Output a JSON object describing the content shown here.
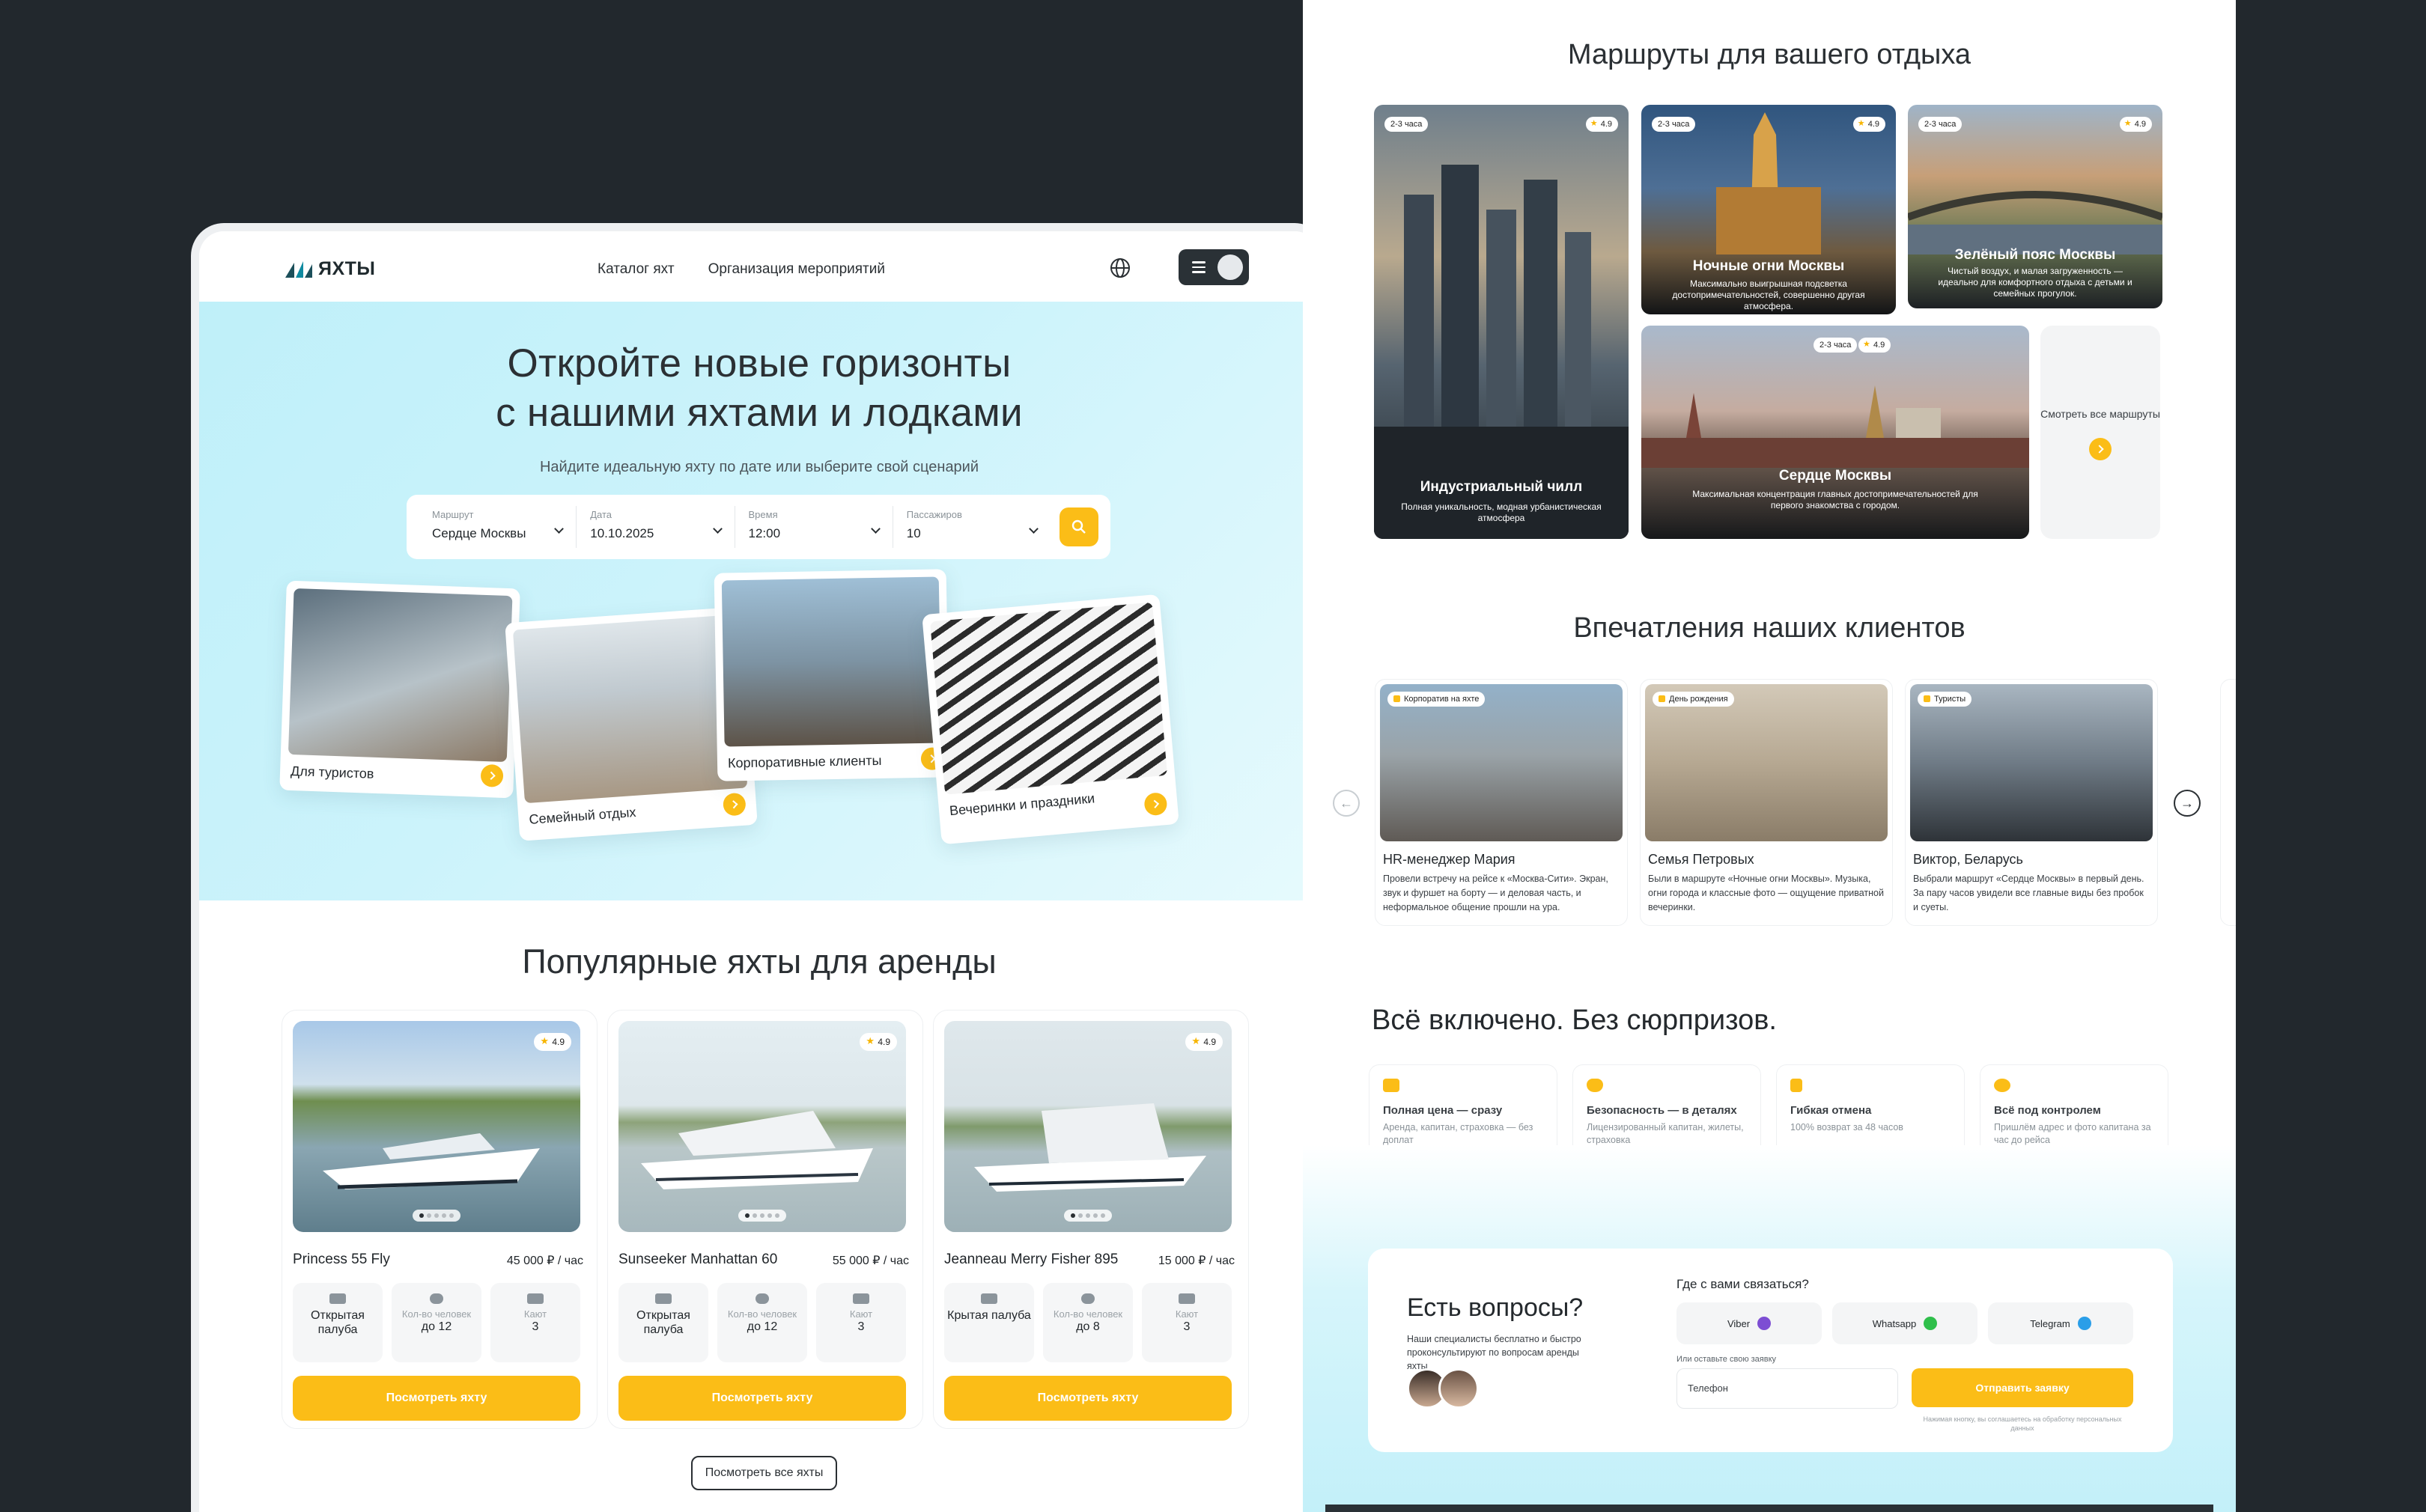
{
  "left": {
    "logo": "ЯХТЫ",
    "nav": [
      "Каталог яхт",
      "Организация мероприятий"
    ],
    "hero": {
      "title_line1": "Откройте новые горизонты",
      "title_line2": "с нашими яхтами и лодками",
      "subtitle": "Найдите идеальную яхту по дате или выберите свой сценарий"
    },
    "search": [
      {
        "label": "Маршрут",
        "value": "Сердце Москвы"
      },
      {
        "label": "Дата",
        "value": "10.10.2025"
      },
      {
        "label": "Время",
        "value": "12:00"
      },
      {
        "label": "Пассажиров",
        "value": "10"
      }
    ],
    "scenarios": [
      "Для туристов",
      "Семейный отдых",
      "Корпоративные клиенты",
      "Вечеринки и праздники"
    ],
    "popular_title": "Популярные яхты для аренды",
    "yachts": [
      {
        "name": "Princess 55 Fly",
        "price": "45 000 ₽ / час",
        "rating": "4.9",
        "deck_label": "Открытая палуба",
        "people_label": "Кол-во человек",
        "people": "до 12",
        "cabins_label": "Кают",
        "cabins": "3",
        "cta": "Посмотреть яхту"
      },
      {
        "name": "Sunseeker Manhattan 60",
        "price": "55 000 ₽ / час",
        "rating": "4.9",
        "deck_label": "Открытая палуба",
        "people_label": "Кол-во человек",
        "people": "до 12",
        "cabins_label": "Кают",
        "cabins": "3",
        "cta": "Посмотреть яхту"
      },
      {
        "name": "Jeanneau Merry Fisher 895",
        "price": "15 000 ₽ / час",
        "rating": "4.9",
        "deck_label": "Крытая палуба",
        "people_label": "Кол-во человек",
        "people": "до 8",
        "cabins_label": "Кают",
        "cabins": "3",
        "cta": "Посмотреть яхту"
      }
    ],
    "all_yachts": "Посмотреть все яхты"
  },
  "right": {
    "routes_title": "Маршруты для вашего отдыха",
    "routes": [
      {
        "badge": "2-3 часа",
        "rating": "4.9",
        "title": "Индустриальный чилл",
        "desc": "Полная уникальность, модная урбанистическая атмосфера"
      },
      {
        "badge": "2-3 часа",
        "rating": "4.9",
        "title": "Ночные огни Москвы",
        "desc": "Максимально выигрышная подсветка достопримечательностей, совершенно другая атмосфера."
      },
      {
        "badge": "2-3 часа",
        "rating": "4.9",
        "title": "Зелёный пояс Москвы",
        "desc": "Чистый воздух, и малая загруженность — идеально для комфортного отдыха с детьми и семейных прогулок."
      },
      {
        "badge": "2-3 часа",
        "rating": "4.9",
        "title": "Сердце Москвы",
        "desc": "Максимальная концентрация главных достопримечательностей для первого знакомства с городом."
      }
    ],
    "routes_more": "Смотреть все маршруты",
    "reviews_title": "Впечатления наших клиентов",
    "reviews": [
      {
        "tag": "Корпоратив на яхте",
        "name": "HR-менеджер Мария",
        "text": "Провели встречу на рейсе к «Москва-Сити». Экран, звук и фуршет на борту — и деловая часть, и неформальное общение прошли на ура."
      },
      {
        "tag": "День рождения",
        "name": "Семья Петровых",
        "text": "Были в маршруте «Ночные огни Москвы». Музыка, огни города и классные фото — ощущение приватной вечеринки."
      },
      {
        "tag": "Туристы",
        "name": "Виктор, Беларусь",
        "text": "Выбрали маршрут «Сердце Москвы» в первый день. За пару часов увидели все главные виды без пробок и суеты."
      }
    ],
    "included_title": "Всё включено. Без сюрпризов.",
    "included": [
      {
        "title": "Полная цена — сразу",
        "desc": "Аренда, капитан, страховка — без доплат"
      },
      {
        "title": "Безопасность — в деталях",
        "desc": "Лицензированный капитан, жилеты, страховка"
      },
      {
        "title": "Гибкая отмена",
        "desc": "100% возврат за 48 часов"
      },
      {
        "title": "Всё под контролем",
        "desc": "Пришлём адрес и фото капитана за час до рейса"
      }
    ],
    "contact": {
      "title": "Есть вопросы?",
      "subtitle": "Наши специалисты бесплатно и быстро проконсультируют по вопросам аренды яхты",
      "where": "Где с вами связаться?",
      "messengers": [
        "Viber",
        "Whatsapp",
        "Telegram"
      ],
      "or_label": "Или оставьте свою заявку",
      "phone_placeholder": "Телефон",
      "submit": "Отправить заявку",
      "note": "Нажимая кнопку, вы соглашаетесь на обработку персональных данных"
    },
    "colors": {
      "accent": "#fbbd17",
      "viber": "#7d4ed3",
      "whatsapp": "#2fbf4b",
      "telegram": "#2a9ee8"
    }
  }
}
